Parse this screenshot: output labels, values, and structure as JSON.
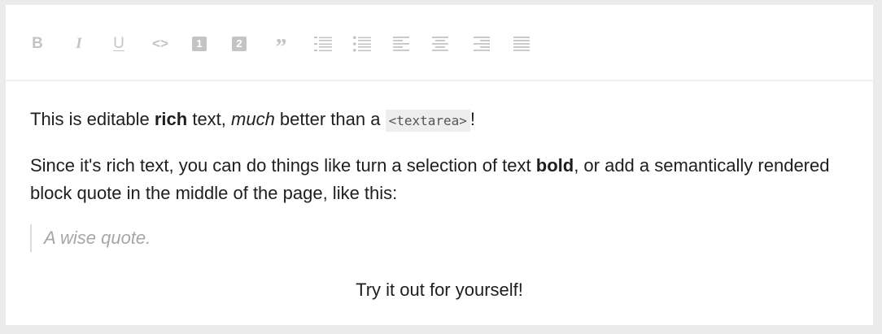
{
  "toolbar": {
    "bold_label": "B",
    "italic_label": "I",
    "underline_label": "U",
    "code_label": "<>",
    "heading_one_label": "1",
    "heading_two_label": "2",
    "quote_label": "”"
  },
  "content": {
    "p1": {
      "t1": "This is editable ",
      "bold": "rich",
      "t2": " text, ",
      "italic": "much",
      "t3": " better than a ",
      "code": "<textarea>",
      "t4": "!"
    },
    "p2": {
      "t1": "Since it's rich text, you can do things like turn a selection of text ",
      "bold": "bold",
      "t2": ", or add a semantically rendered block quote in the middle of the page, like this:"
    },
    "quote": "A wise quote.",
    "center": "Try it out for yourself!"
  },
  "colors": {
    "toolbar_icon": "#c4c4c4",
    "text": "#1e1e1e",
    "quote_text": "#a6a6a6",
    "background": "#ebebeb",
    "editor": "#ffffff"
  }
}
